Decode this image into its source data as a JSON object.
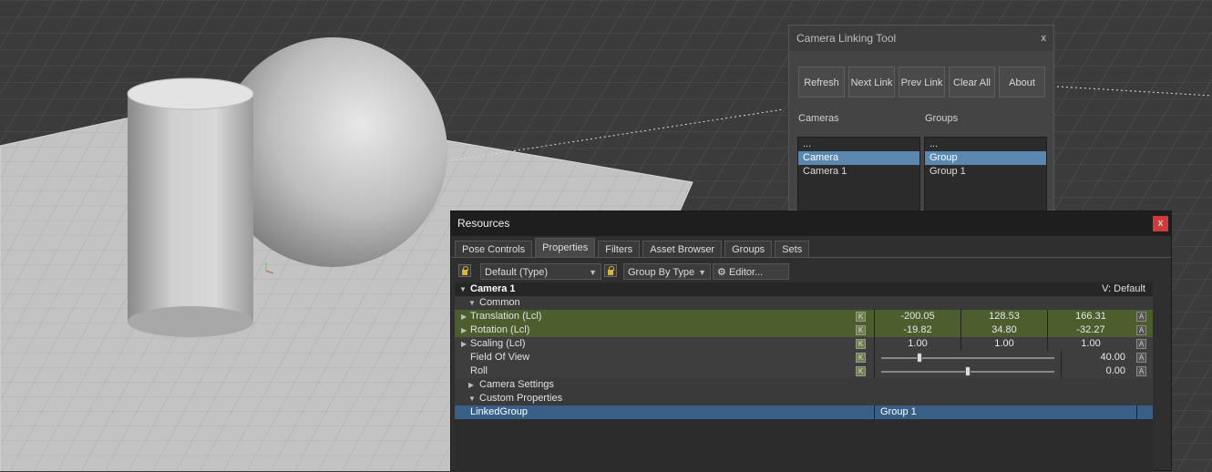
{
  "camera_tool": {
    "title": "Camera Linking Tool",
    "close": "x",
    "buttons": [
      "Refresh",
      "Next Link",
      "Prev Link",
      "Clear All",
      "About"
    ],
    "cameras_label": "Cameras",
    "groups_label": "Groups",
    "cameras": [
      "...",
      "Camera",
      "Camera 1"
    ],
    "groups": [
      "...",
      "Group",
      "Group 1"
    ],
    "selected_camera": "Camera",
    "selected_group": "Group"
  },
  "resources": {
    "title": "Resources",
    "close": "x",
    "tabs": [
      "Pose Controls",
      "Properties",
      "Filters",
      "Asset Browser",
      "Groups",
      "Sets"
    ],
    "active_tab": "Properties",
    "filter_combo": "Default (Type)",
    "group_combo": "Group By Type",
    "editor_button": "Editor...",
    "object_name": "Camera 1",
    "view_label": "V: Default",
    "common_label": "Common",
    "properties": [
      {
        "name": "Translation (Lcl)",
        "k": "K",
        "values": [
          "-200.05",
          "128.53",
          "166.31"
        ],
        "a": "A"
      },
      {
        "name": "Rotation (Lcl)",
        "k": "K",
        "values": [
          "-19.82",
          "34.80",
          "-32.27"
        ],
        "a": "A"
      },
      {
        "name": "Scaling (Lcl)",
        "k": "K",
        "values": [
          "1.00",
          "1.00",
          "1.00"
        ],
        "a": "A"
      }
    ],
    "field_of_view": {
      "name": "Field Of View",
      "k": "K",
      "value": "40.00",
      "a": "A",
      "slider": 0.22
    },
    "roll": {
      "name": "Roll",
      "k": "K",
      "value": "0.00",
      "a": "A",
      "slider": 0.5
    },
    "camera_settings_label": "Camera Settings",
    "custom_properties_label": "Custom Properties",
    "linked_group": {
      "name": "LinkedGroup",
      "value": "Group 1"
    }
  }
}
